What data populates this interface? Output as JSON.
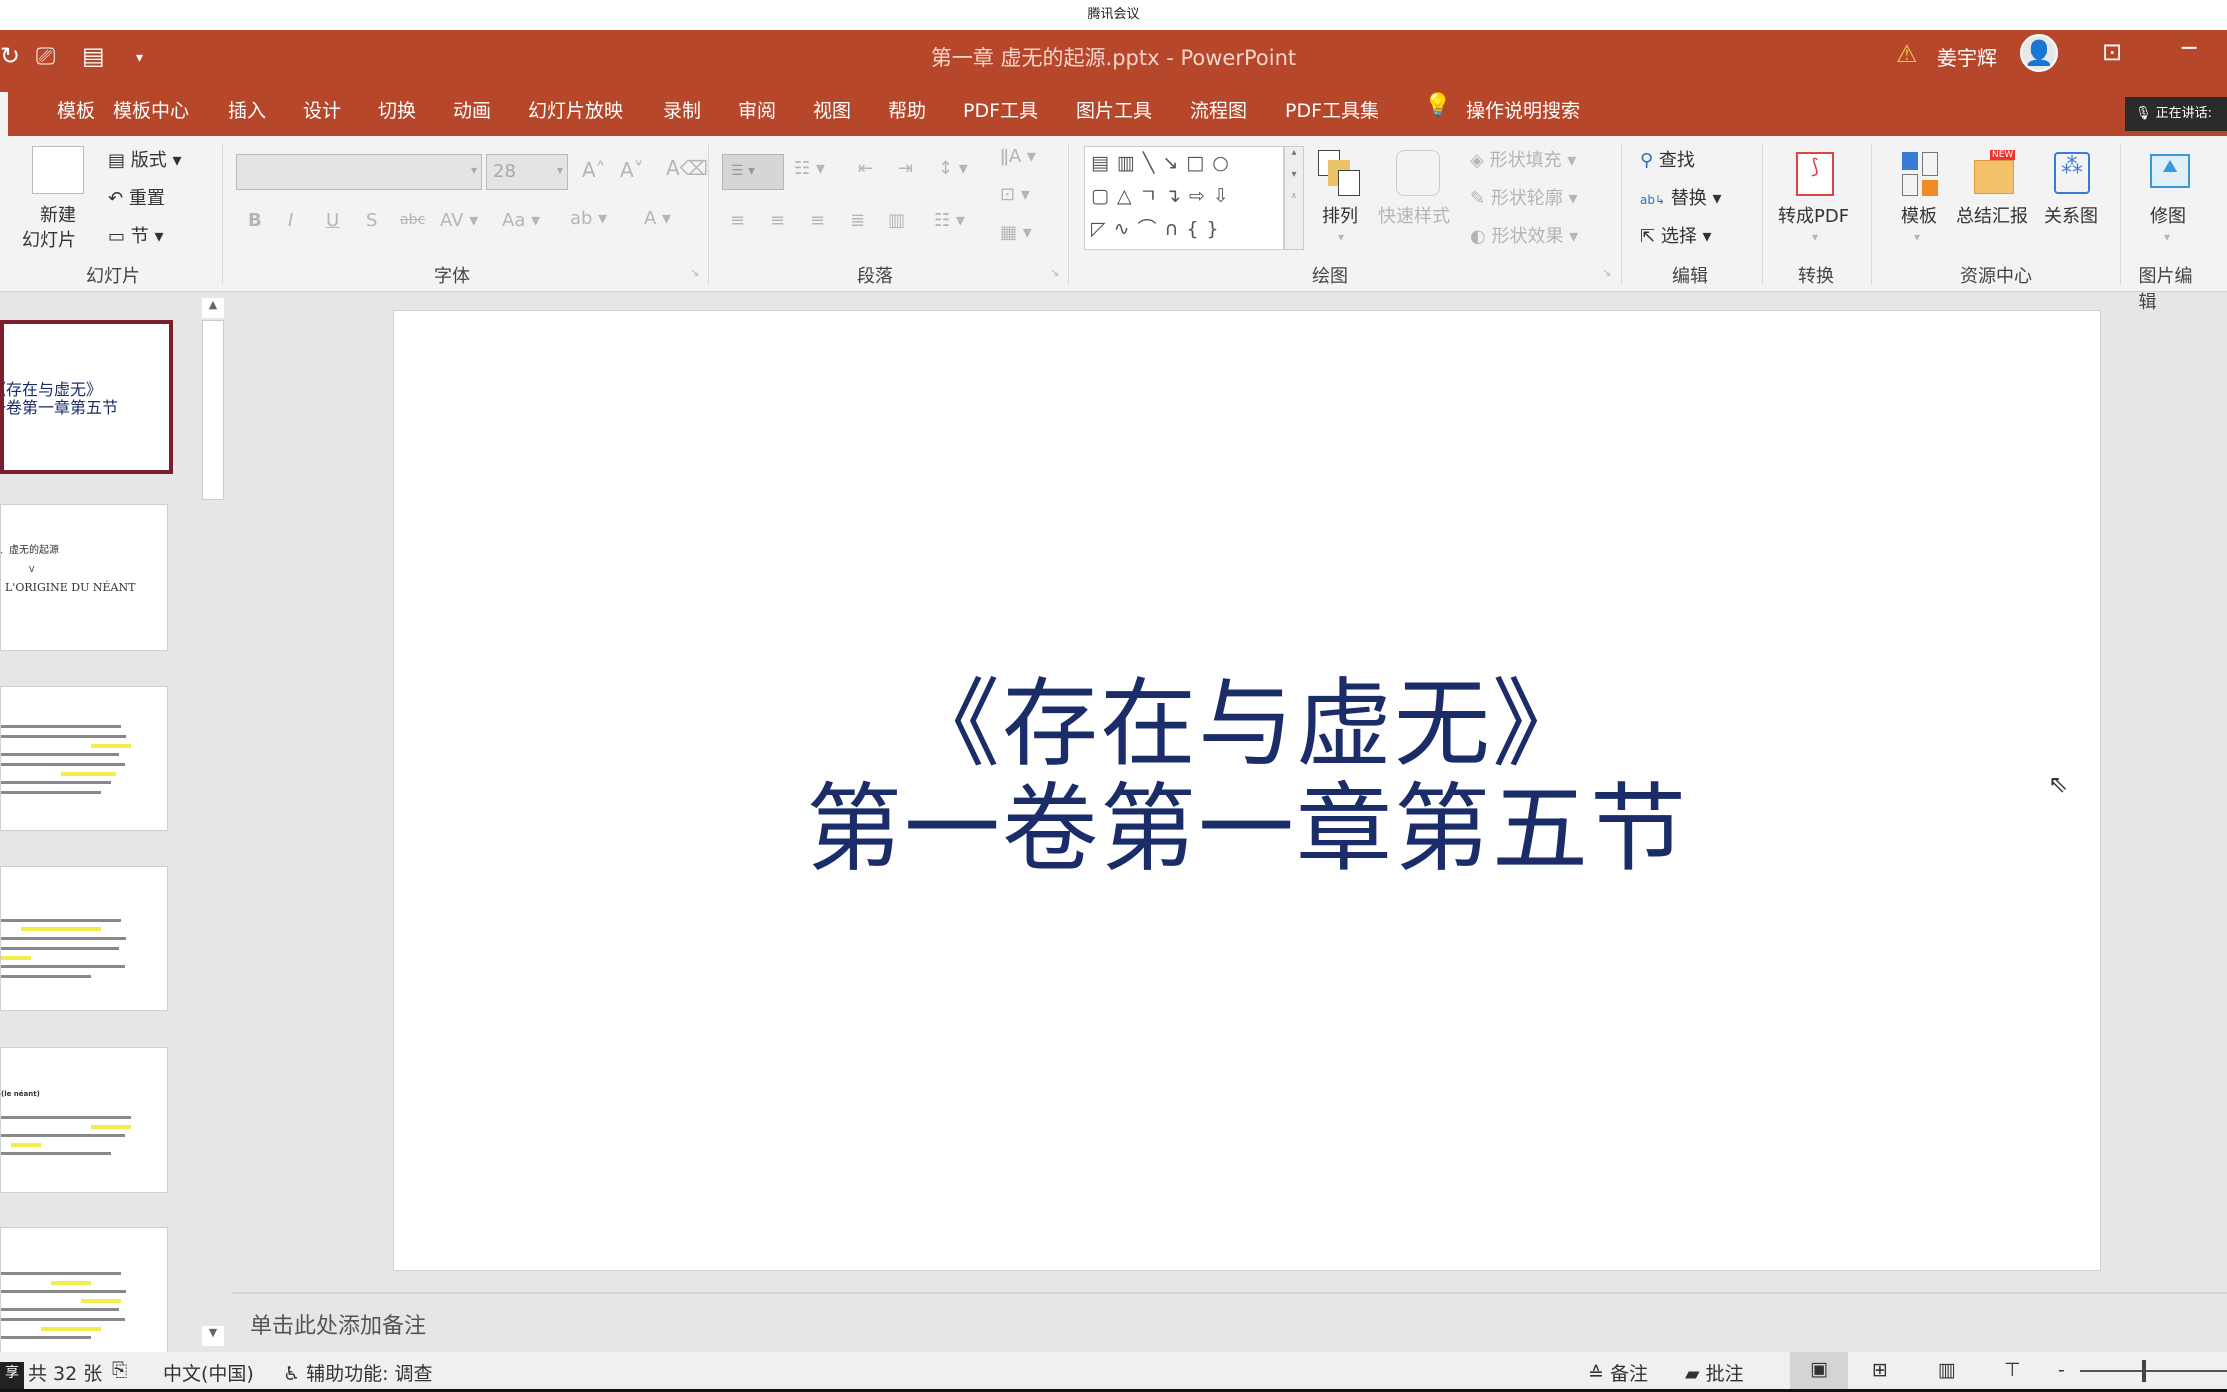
{
  "meeting_app": {
    "title": "腾讯会议",
    "speaking_label": "正在讲话:",
    "share_badge": "享"
  },
  "titlebar": {
    "document_title": "第一章 虚无的起源.pptx - PowerPoint",
    "user_name": "姜宇辉",
    "accent_color": "#b7472a"
  },
  "tabs": [
    "模板",
    "模板中心",
    "插入",
    "设计",
    "切换",
    "动画",
    "幻灯片放映",
    "录制",
    "审阅",
    "视图",
    "帮助",
    "PDF工具",
    "图片工具",
    "流程图",
    "PDF工具集"
  ],
  "tell_me": "操作说明搜索",
  "ribbon": {
    "slides": {
      "label": "幻灯片",
      "new_slide_line1": "新建",
      "new_slide_line2": "幻灯片",
      "layout": "版式",
      "reset": "重置",
      "section": "节"
    },
    "font": {
      "label": "字体",
      "font_name": "",
      "font_size": "28"
    },
    "paragraph": {
      "label": "段落"
    },
    "drawing": {
      "label": "绘图",
      "arrange": "排列",
      "quick_styles": "快速样式",
      "shape_fill": "形状填充",
      "shape_outline": "形状轮廓",
      "shape_effects": "形状效果"
    },
    "editing": {
      "label": "编辑",
      "find": "查找",
      "replace": "替换",
      "select": "选择"
    },
    "convert": {
      "label": "转换",
      "to_pdf": "转成PDF"
    },
    "resources": {
      "label": "资源中心",
      "template": "模板",
      "summary": "总结汇报",
      "new_badge": "NEW",
      "relation": "关系图"
    },
    "picture_edit": {
      "label": "图片编辑",
      "retouch": "修图"
    }
  },
  "thumbnails": [
    {
      "line1": "《存在与虚无》",
      "line2": "第一卷第一章第五节",
      "selected": true
    },
    {
      "line1": "五、虚无的起源",
      "line2": "V",
      "line3": "L'ORIGINE DU NÉANT"
    },
    {},
    {},
    {
      "line1": "(le néant)"
    },
    {}
  ],
  "slide": {
    "title_line1": "《存在与虚无》",
    "title_line2": "第一卷第一章第五节",
    "text_color": "#1b2d68"
  },
  "notes_placeholder": "单击此处添加备注",
  "status": {
    "slide_count": "共 32 张",
    "language": "中文(中国)",
    "accessibility": "辅助功能: 调查",
    "notes": "备注",
    "comments": "批注"
  }
}
